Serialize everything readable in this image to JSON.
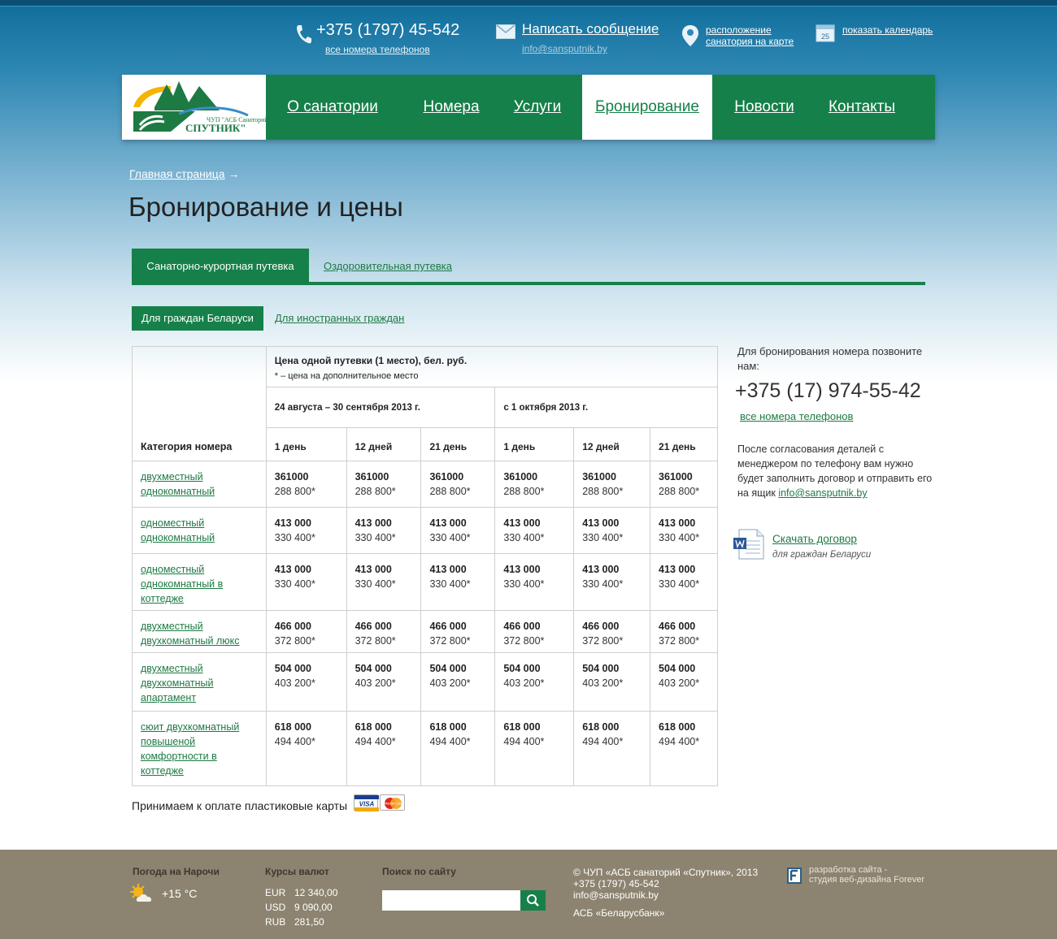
{
  "header": {
    "phone": "+375 (1797) 45-542",
    "all_phones": "все номера телефонов",
    "write_message": "Написать сообщение",
    "email": "info@sansputnik.by",
    "map_link_line1": "расположение",
    "map_link_line2": "санатория на карте",
    "calendar_link": "показать календарь",
    "calendar_day": "25"
  },
  "logo": {
    "line1": "ЧУП \"АСБ Санаторий",
    "line2": "СПУТНИК\""
  },
  "nav": {
    "items": [
      {
        "label": "О санатории"
      },
      {
        "label": "Номера"
      },
      {
        "label": "Услуги"
      },
      {
        "label": "Бронирование"
      },
      {
        "label": "Новости"
      },
      {
        "label": "Контакты"
      }
    ],
    "active": "Бронирование"
  },
  "breadcrumb": {
    "home": "Главная страница",
    "arrow": "→"
  },
  "page_title": "Бронирование и цены",
  "tabs": {
    "active": "Санаторно-курортная путевка",
    "other": "Оздоровительная путевка"
  },
  "subtabs": {
    "active": "Для граждан Беларуси",
    "other": "Для иностранных граждан"
  },
  "table": {
    "category_header": "Категория номера",
    "price_header": "Цена одной путевки (1 место), бел. руб.",
    "price_note": "* – цена на дополнительное место",
    "periods": [
      "24 августа – 30 сентября 2013 г.",
      "с 1 октября 2013 г."
    ],
    "durations": [
      "1 день",
      "12 дней",
      "21 день",
      "1 день",
      "12 дней",
      "21 день"
    ],
    "rows": [
      {
        "category": "двухместный однокомнатный",
        "price": "361000",
        "extra": "288 800*"
      },
      {
        "category": "одноместный однокомнатный",
        "price": "413 000",
        "extra": "330 400*"
      },
      {
        "category": "одноместный однокомнатный в коттедже",
        "price": "413 000",
        "extra": "330 400*"
      },
      {
        "category": "двухместный двухкомнатный люкс",
        "price": "466 000",
        "extra": "372 800*"
      },
      {
        "category": "двухместный двухкомнатный апартамент",
        "price": "504 000",
        "extra": "403 200*"
      },
      {
        "category": "сюит двухкомнатный повышеной комфортности в коттедже",
        "price": "618 000",
        "extra": "494 400*"
      }
    ]
  },
  "cards_text": "Принимаем к оплате пластиковые карты",
  "cards": {
    "visa": "VISA",
    "mastercard": "MasterCard"
  },
  "sidebar": {
    "intro": "Для бронирования номера позвоните нам:",
    "phone": "+375 (17) 974-55-42",
    "all_phones": "все номера телефонов",
    "note": "После согласования деталей с менеджером по телефону вам нужно будет заполнить договор и отправить его на ящик",
    "note_email": "info@sansputnik.by",
    "download": "Скачать договор",
    "download_sub": "для граждан Беларуси"
  },
  "footer": {
    "weather_title": "Погода на Нарочи",
    "temperature": "+15 °C",
    "rates_title": "Курсы валют",
    "rates": [
      {
        "cur": "EUR",
        "value": "12 340,00"
      },
      {
        "cur": "USD",
        "value": "9 090,00"
      },
      {
        "cur": "RUB",
        "value": "281,50"
      }
    ],
    "search_title": "Поиск по сайту",
    "copyright": "©  ЧУП «АСБ санаторий «Спутник», 2013",
    "phone": "+375 (1797) 45-542",
    "email": "info@sansputnik.by",
    "bank": "АСБ «Беларусбанк»",
    "dev_line1": "разработка сайта -",
    "dev_line2": "студия веб-дизайна Forever"
  },
  "colors": {
    "brand_green": "#16804a",
    "sky_blue": "#1c77a6",
    "footer_bg": "#8c8470"
  }
}
